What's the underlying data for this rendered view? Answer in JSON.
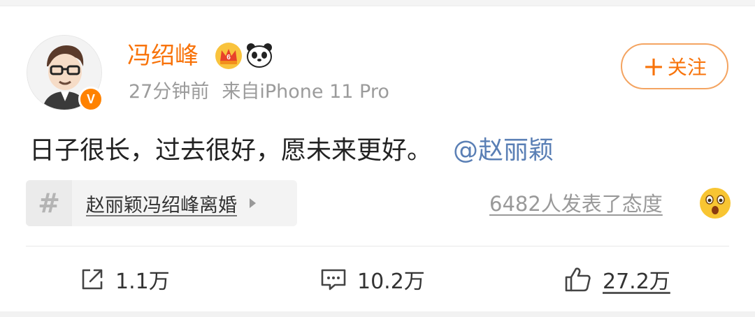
{
  "post": {
    "username": "冯绍峰",
    "time": "27分钟前",
    "source": "来自iPhone 11 Pro",
    "follow_label": "关注",
    "text": "日子很长，过去很好，愿未来更好。",
    "mention": "@赵丽颖",
    "topic": "赵丽颖冯绍峰离婚",
    "reactions": "6482人发表了态度",
    "verified_badge": "V"
  },
  "actions": {
    "repost_count": "1.1万",
    "comment_count": "10.2万",
    "like_count": "27.2万"
  },
  "colors": {
    "username": "#f8730a",
    "mention": "#5a7fb5",
    "muted": "#9b9b9b",
    "verified": "#ff8200"
  },
  "icons": [
    "crown-icon",
    "panda-icon",
    "hash-icon",
    "wow-emoji-icon",
    "repost-icon",
    "comment-icon",
    "like-icon"
  ]
}
